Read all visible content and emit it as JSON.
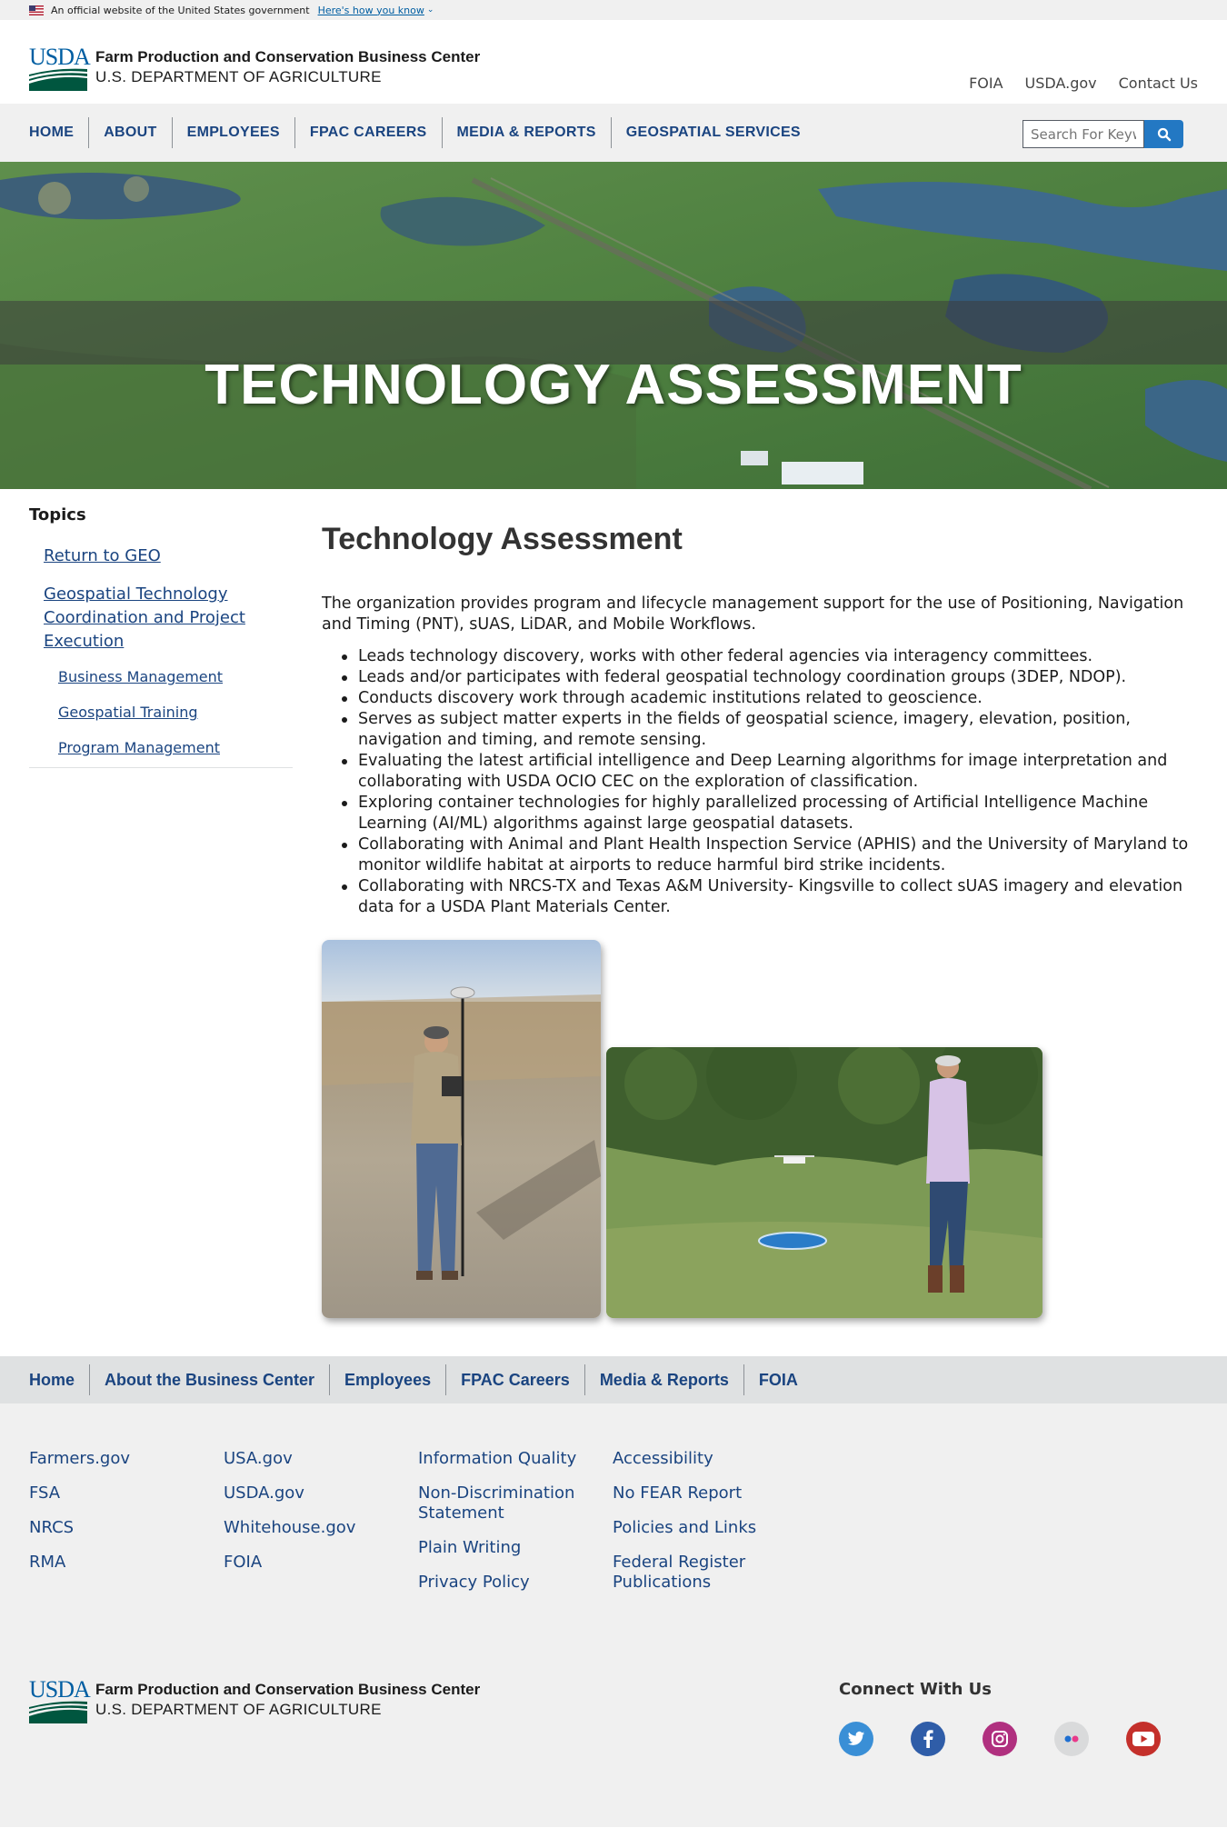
{
  "gov_banner": {
    "text": "An official website of the United States government",
    "link": "Here's how you know",
    "chevron": "⌄"
  },
  "header": {
    "logo_text": "USDA",
    "org_line1": "Farm Production and Conservation Business Center",
    "org_line2": "U.S. DEPARTMENT OF AGRICULTURE",
    "util_links": [
      "FOIA",
      "USDA.gov",
      "Contact Us"
    ]
  },
  "nav": {
    "items": [
      "HOME",
      "ABOUT",
      "EMPLOYEES",
      "FPAC CAREERS",
      "MEDIA & REPORTS",
      "GEOSPATIAL SERVICES"
    ],
    "search_placeholder": "Search For Keyw"
  },
  "hero": {
    "title": "TECHNOLOGY ASSESSMENT"
  },
  "sidebar": {
    "heading": "Topics",
    "links": [
      "Return to GEO",
      "Geospatial Technology Coordination and Project Execution"
    ],
    "sublinks": [
      "Business Management",
      "Geospatial Training",
      "Program Management"
    ]
  },
  "main": {
    "heading": "Technology Assessment",
    "intro": "The organization provides program and lifecycle management support for the use of Positioning, Navigation and Timing (PNT), sUAS, LiDAR, and Mobile Workflows.",
    "bullets": [
      "Leads technology discovery, works with other federal agencies via interagency committees.",
      "Leads and/or participates with federal geospatial technology coordination groups (3DEP, NDOP).",
      "Conducts discovery work through academic institutions related to geoscience.",
      "Serves as subject matter experts in the fields of geospatial science, imagery, elevation, position, navigation and timing, and remote sensing.",
      "Evaluating the latest artificial intelligence and Deep Learning algorithms for image interpretation and collaborating with USDA OCIO CEC on the exploration of classification.",
      "Exploring container technologies for highly parallelized processing of Artificial Intelligence Machine Learning (AI/ML) algorithms against large geospatial datasets.",
      "Collaborating with Animal and Plant Health Inspection Service (APHIS) and the University of Maryland to monitor wildlife habitat at airports to reduce harmful bird strike incidents.",
      "Collaborating with NRCS-TX and Texas A&M University- Kingsville to collect sUAS imagery and elevation data for a USDA Plant Materials Center."
    ]
  },
  "footer_nav": {
    "items": [
      "Home",
      "About the Business Center",
      "Employees",
      "FPAC Careers",
      "Media & Reports",
      "FOIA"
    ]
  },
  "footer": {
    "col1": [
      "Farmers.gov",
      "FSA",
      "NRCS",
      "RMA"
    ],
    "col2": [
      "USA.gov",
      "USDA.gov",
      "Whitehouse.gov",
      "FOIA"
    ],
    "col3": [
      "Information Quality",
      "Non-Discrimination Statement",
      "Plain Writing",
      "Privacy Policy"
    ],
    "col4": [
      "Accessibility",
      "No FEAR Report",
      "Policies and Links",
      "Federal Register Publications"
    ],
    "connect_heading": "Connect With Us",
    "social_icons": [
      "twitter-icon",
      "facebook-icon",
      "instagram-icon",
      "flickr-icon",
      "youtube-icon"
    ],
    "social_colors": [
      "#3a8fd6",
      "#2f5da8",
      "#b0307f",
      "#d9dadb",
      "#c4302b"
    ]
  }
}
